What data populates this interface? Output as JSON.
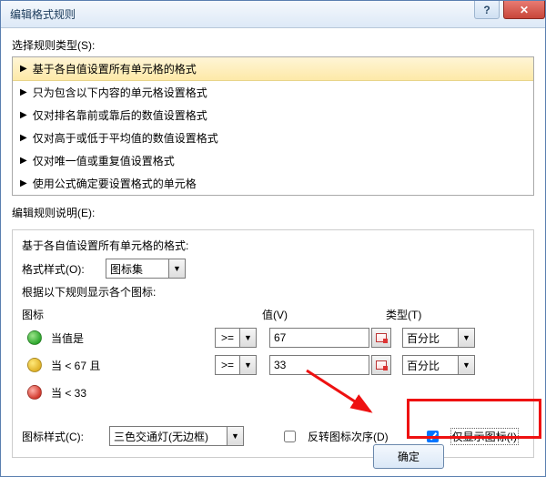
{
  "titlebar": {
    "title": "编辑格式规则"
  },
  "section1_label": "选择规则类型(S):",
  "rules": [
    "基于各自值设置所有单元格的格式",
    "只为包含以下内容的单元格设置格式",
    "仅对排名靠前或靠后的数值设置格式",
    "仅对高于或低于平均值的数值设置格式",
    "仅对唯一值或重复值设置格式",
    "使用公式确定要设置格式的单元格"
  ],
  "section2_label": "编辑规则说明(E):",
  "based_on_label": "基于各自值设置所有单元格的格式:",
  "format_style_label": "格式样式(O):",
  "format_style_value": "图标集",
  "display_label": "根据以下规则显示各个图标:",
  "cols": {
    "icon": "图标",
    "value": "值(V)",
    "type": "类型(T)"
  },
  "rows": [
    {
      "label": "当值是",
      "op": ">=",
      "val": "67",
      "type": "百分比",
      "color": "green"
    },
    {
      "label": "当 < 67 且",
      "op": ">=",
      "val": "33",
      "type": "百分比",
      "color": "yellow"
    },
    {
      "label": "当 < 33",
      "color": "red"
    }
  ],
  "icon_style_label": "图标样式(C):",
  "icon_style_value": "三色交通灯(无边框)",
  "reverse_label": "反转图标次序(D)",
  "show_only_label": "仅显示图标(I)",
  "ok_btn": "确定"
}
